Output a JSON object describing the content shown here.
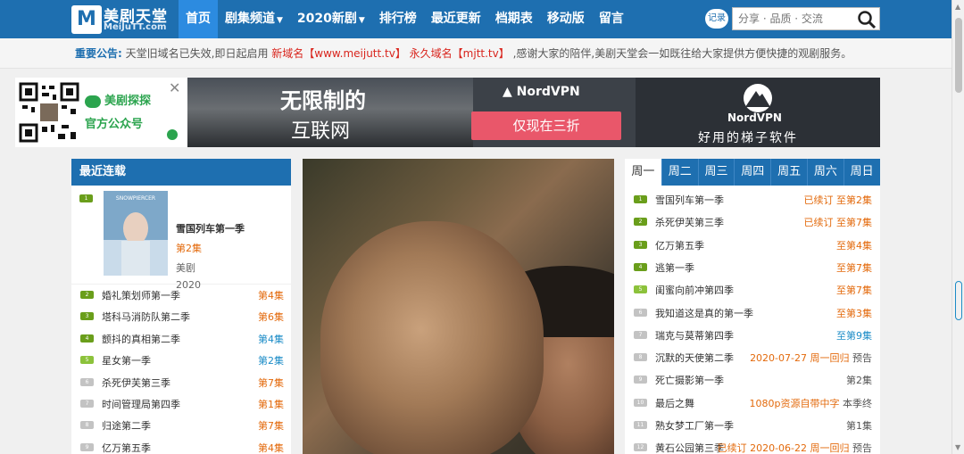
{
  "nav": {
    "logo_cn": "美剧天堂",
    "logo_en": "MeiJuTT.com",
    "items": [
      {
        "label": "首页",
        "active": true
      },
      {
        "label": "剧集频道",
        "caret": true
      },
      {
        "label": "2020新剧",
        "caret": true
      },
      {
        "label": "排行榜"
      },
      {
        "label": "最近更新"
      },
      {
        "label": "档期表"
      },
      {
        "label": "移动版"
      },
      {
        "label": "留言"
      }
    ],
    "record_label": "记录",
    "search_placeholder": "分享 · 品质 · 交流"
  },
  "notice": {
    "label": "重要公告:",
    "text1": "天堂旧域名已失效,即日起启用",
    "new_domain": "新域名【www.meijutt.tv】",
    "perm_domain": "永久域名【mjtt.tv】",
    "text2": ",感谢大家的陪伴,美剧天堂会一如既往给大家提供方便快捷的观剧服务。"
  },
  "ad": {
    "wechat_line1": "美剧探探",
    "wechat_line2": "官方公众号",
    "slogan1": "无限制的",
    "slogan2": "互联网",
    "brand": "NordVPN",
    "button": "仅现在三折",
    "brand2": "NordVPN",
    "tagline": "好用的梯子软件"
  },
  "recent": {
    "header": "最近连载",
    "featured": {
      "num": "1",
      "title": "雪国列车第一季",
      "episode": "第2集",
      "category": "美剧",
      "year": "2020",
      "poster_text": "SNOWPIERCER"
    },
    "items": [
      {
        "num": "2",
        "title": "婚礼策划师第一季",
        "ep": "第4集",
        "color": "or"
      },
      {
        "num": "3",
        "title": "塔科马消防队第二季",
        "ep": "第6集",
        "color": "or"
      },
      {
        "num": "4",
        "title": "颤抖的真相第二季",
        "ep": "第4集",
        "color": "bl"
      },
      {
        "num": "5",
        "title": "星女第一季",
        "ep": "第2集",
        "color": "bl"
      },
      {
        "num": "6",
        "title": "杀死伊芙第三季",
        "ep": "第7集",
        "color": "or"
      },
      {
        "num": "7",
        "title": "时间管理局第四季",
        "ep": "第1集",
        "color": "or"
      },
      {
        "num": "8",
        "title": "归途第二季",
        "ep": "第7集",
        "color": "or"
      },
      {
        "num": "9",
        "title": "亿万第五季",
        "ep": "第4集",
        "color": "or"
      }
    ]
  },
  "schedule": {
    "tabs": [
      "周一",
      "周二",
      "周三",
      "周四",
      "周五",
      "周六",
      "周日"
    ],
    "active_tab": 0,
    "items": [
      {
        "num": "1",
        "title": "雪国列车第一季",
        "status": "已续订",
        "ep": "至第2集",
        "st_color": "or",
        "ep_color": "or"
      },
      {
        "num": "2",
        "title": "杀死伊芙第三季",
        "status": "已续订",
        "ep": "至第7集",
        "st_color": "or",
        "ep_color": "or"
      },
      {
        "num": "3",
        "title": "亿万第五季",
        "status": "",
        "ep": "至第4集",
        "st_color": "",
        "ep_color": "or"
      },
      {
        "num": "4",
        "title": "逃第一季",
        "status": "",
        "ep": "至第7集",
        "st_color": "",
        "ep_color": "or"
      },
      {
        "num": "5",
        "title": "闺蜜向前冲第四季",
        "status": "",
        "ep": "至第7集",
        "st_color": "",
        "ep_color": "or"
      },
      {
        "num": "6",
        "title": "我知道这是真的第一季",
        "status": "",
        "ep": "至第3集",
        "st_color": "",
        "ep_color": "or"
      },
      {
        "num": "7",
        "title": "瑞克与莫蒂第四季",
        "status": "",
        "ep": "至第9集",
        "st_color": "",
        "ep_color": "bl"
      },
      {
        "num": "8",
        "title": "沉默的天使第二季",
        "status": "2020-07-27 周一回归",
        "ep": "预告",
        "st_color": "or",
        "ep_color": "gy"
      },
      {
        "num": "9",
        "title": "死亡摄影第一季",
        "status": "",
        "ep": "第2集",
        "st_color": "",
        "ep_color": "gy"
      },
      {
        "num": "10",
        "title": "最后之舞",
        "status": "1080p资源自带中字",
        "ep": "本季终",
        "st_color": "or",
        "ep_color": "gy"
      },
      {
        "num": "11",
        "title": "熟女梦工厂第一季",
        "status": "",
        "ep": "第1集",
        "st_color": "",
        "ep_color": "gy"
      },
      {
        "num": "12",
        "title": "黄石公园第三季",
        "status": "已续订 2020-06-22 周一回归",
        "ep": "预告",
        "st_color": "or",
        "ep_color": "gy"
      }
    ]
  }
}
